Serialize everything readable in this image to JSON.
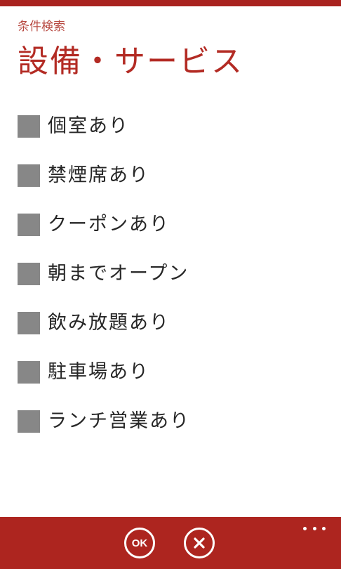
{
  "header": {
    "subtitle": "条件検索",
    "title": "設備・サービス"
  },
  "options": [
    {
      "label": "個室あり",
      "checked": false
    },
    {
      "label": "禁煙席あり",
      "checked": false
    },
    {
      "label": "クーポンあり",
      "checked": false
    },
    {
      "label": "朝までオープン",
      "checked": false
    },
    {
      "label": "飲み放題あり",
      "checked": false
    },
    {
      "label": "駐車場あり",
      "checked": false
    },
    {
      "label": "ランチ営業あり",
      "checked": false
    }
  ],
  "app_bar": {
    "ok_label": "OK",
    "ok_icon": "ok-circle-icon",
    "cancel_icon": "close-circle-icon",
    "more_icon": "ellipsis-icon"
  },
  "colors": {
    "accent": "#ad251f",
    "title": "#b32b24",
    "checkbox": "#878787",
    "text": "#262626"
  }
}
